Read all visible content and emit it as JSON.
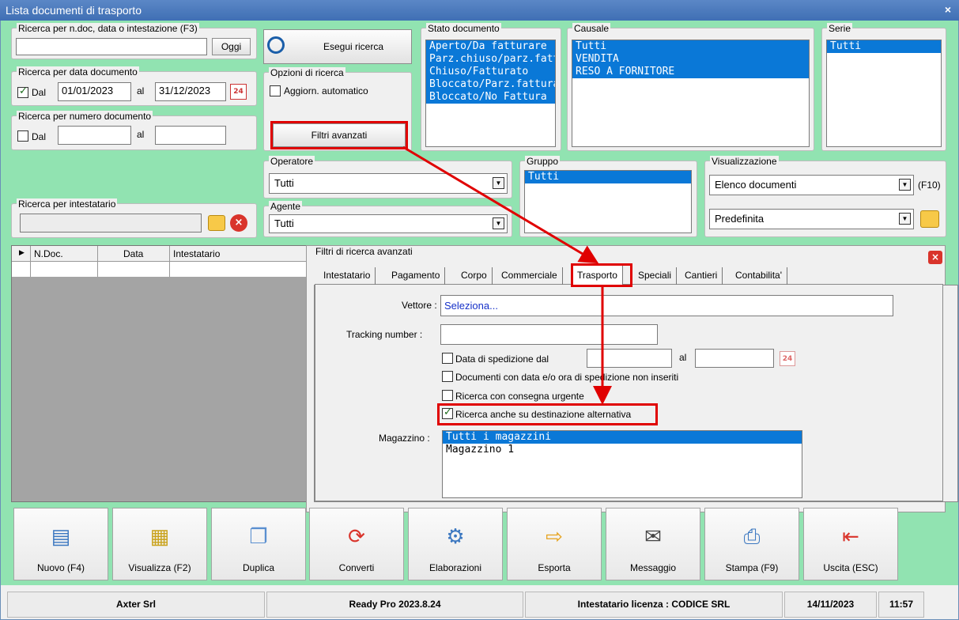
{
  "window": {
    "title": "Lista documenti di trasporto",
    "close": "×"
  },
  "search": {
    "ndoc": {
      "title": "Ricerca per n.doc, data o intestazione (F3)",
      "value": "",
      "today": "Oggi"
    },
    "date": {
      "title": "Ricerca per data documento",
      "from_label": "Dal",
      "from": "01/01/2023",
      "to_label": "al",
      "to": "31/12/2023",
      "calendar": "24"
    },
    "number": {
      "title": "Ricerca per numero documento",
      "from_label": "Dal",
      "to_label": "al"
    },
    "holder": {
      "title": "Ricerca per intestatario"
    },
    "execute": "Esegui ricerca",
    "options": {
      "title": "Opzioni di ricerca",
      "auto": "Aggiorn. automatico"
    },
    "advanced_button": "Filtri avanzati"
  },
  "stato": {
    "title": "Stato documento",
    "items": [
      "Aperto/Da fatturare",
      "Parz.chiuso/parz.fattur",
      "Chiuso/Fatturato",
      "Bloccato/Parz.fatturato",
      "Bloccato/No Fattura"
    ]
  },
  "causale": {
    "title": "Causale",
    "items": [
      "Tutti",
      "VENDITA",
      "RESO A FORNITORE"
    ]
  },
  "serie": {
    "title": "Serie",
    "items": [
      "Tutti"
    ]
  },
  "operatore": {
    "title": "Operatore",
    "value": "Tutti"
  },
  "agente": {
    "title": "Agente",
    "value": "Tutti"
  },
  "gruppo": {
    "title": "Gruppo",
    "items": [
      "Tutti"
    ]
  },
  "visual": {
    "title": "Visualizzazione",
    "view": "Elenco documenti",
    "shortcut": "(F10)",
    "preset": "Predefinita"
  },
  "grid": {
    "columns": [
      "N.Doc.",
      "Data",
      "Intestatario"
    ]
  },
  "adv": {
    "title": "Filtri di ricerca avanzati",
    "tabs": [
      "Intestatario",
      "Pagamento",
      "Corpo",
      "Commerciale",
      "Trasporto",
      "Speciali",
      "Cantieri",
      "Contabilita'"
    ],
    "vettore_label": "Vettore :",
    "vettore_value": "Seleziona...",
    "tracking_label": "Tracking number :",
    "ship_date": "Data di spedizione dal",
    "ship_to": "al",
    "ship_cal": "24",
    "no_ship": "Documenti con data e/o ora di spedizione non inseriti",
    "urgent": "Ricerca con consegna urgente",
    "alt_dest": "Ricerca anche su destinazione alternativa",
    "mag_label": "Magazzino :",
    "mag_items": [
      "Tutti i magazzini",
      "Magazzino 1"
    ]
  },
  "toolbar": [
    "Nuovo (F4)",
    "Visualizza (F2)",
    "Duplica",
    "Converti",
    "Elaborazioni",
    "Esporta",
    "Messaggio",
    "Stampa (F9)",
    "Uscita (ESC)"
  ],
  "statusbar": {
    "company": "Axter Srl",
    "version": "Ready Pro 2023.8.24",
    "license": "Intestatario licenza : CODICE SRL",
    "date": "14/11/2023",
    "time": "11:57"
  },
  "colors": {
    "accent": "#0a78d7",
    "highlight": "#e00000",
    "background": "#91e3b1"
  }
}
